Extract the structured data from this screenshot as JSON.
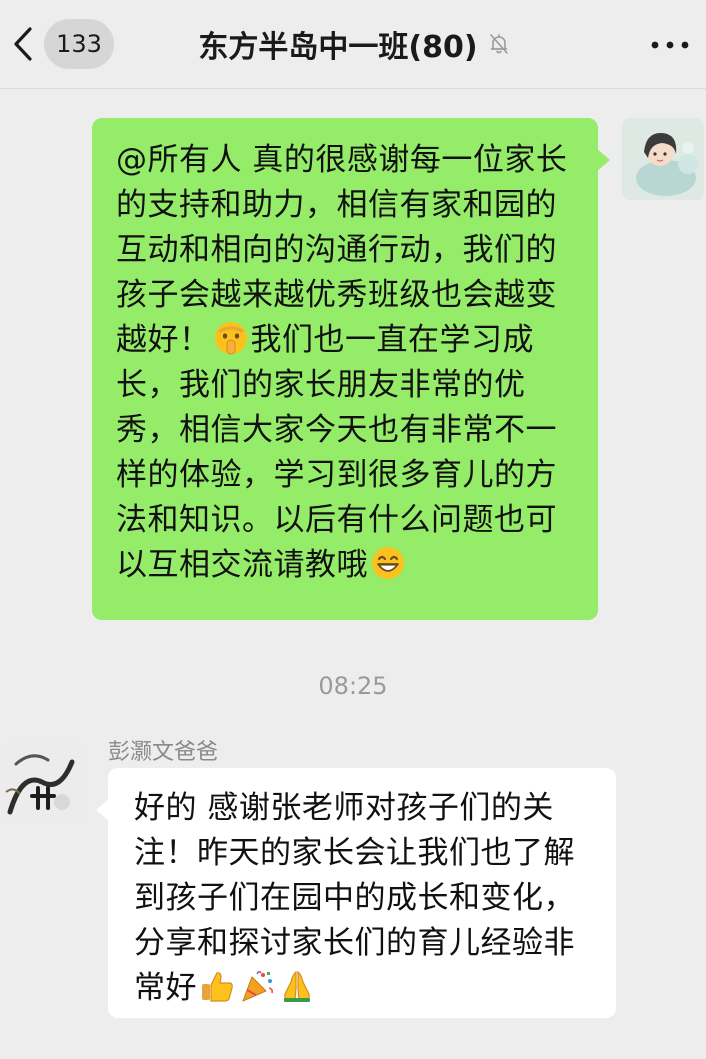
{
  "header": {
    "unread_count": "133",
    "title": "东方半岛中一班(80)",
    "back_icon": "chevron-left-icon",
    "mute_icon": "bell-muted-icon",
    "more_icon": "more-dots-icon"
  },
  "colors": {
    "self_bubble": "#95ec69",
    "other_bubble": "#ffffff",
    "background": "#ededed"
  },
  "messages": [
    {
      "sender": "self",
      "text_before_emoji": "@所有人 真的很感谢每一位家长的支持和助力，相信有家和园的互动和相向的沟通行动，我们的孩子会越来越优秀班级也会越变越好！",
      "emoji_1": "shush-emoji",
      "text_after_emoji": "我们也一直在学习成长，我们的家长朋友非常的优秀，相信大家今天也有非常不一样的体验，学习到很多育儿的方法和知识。以后有什么问题也可以互相交流请教哦",
      "emoji_2": "grin-emoji"
    },
    {
      "timestamp": "08:25"
    },
    {
      "sender_name": "彭灏文爸爸",
      "text": "好的 感谢张老师对孩子们的关注！昨天的家长会让我们也了解到孩子们在园中的成长和变化，分享和探讨家长们的育儿经验非常好",
      "emojis": [
        "thumbs-up-emoji",
        "party-popper-emoji",
        "folded-hands-emoji"
      ]
    }
  ]
}
